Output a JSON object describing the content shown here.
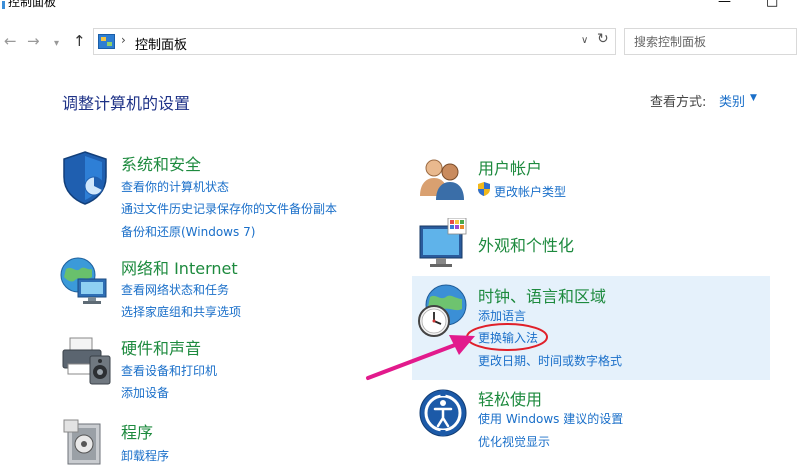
{
  "window": {
    "title": "控制面板",
    "minimize": "—",
    "maximize": "□"
  },
  "nav": {
    "back": "←",
    "forward": "→",
    "recent": "▾",
    "up": "↑",
    "breadcrumb_sep": "›",
    "breadcrumb": "控制面板",
    "dropdown": "∨",
    "refresh": "↻",
    "search_placeholder": "搜索控制面板"
  },
  "header": {
    "title": "调整计算机的设置",
    "view_by_label": "查看方式:",
    "view_by_value": "类别",
    "view_by_caret": "▼"
  },
  "categories": [
    {
      "title": "系统和安全",
      "icon": "shield-icon",
      "links": [
        "查看你的计算机状态",
        "通过文件历史记录保存你的文件备份副本",
        "备份和还原(Windows 7)"
      ]
    },
    {
      "title": "网络和 Internet",
      "icon": "network-globe-icon",
      "links": [
        "查看网络状态和任务",
        "选择家庭组和共享选项"
      ]
    },
    {
      "title": "硬件和声音",
      "icon": "printer-icon",
      "links": [
        "查看设备和打印机",
        "添加设备"
      ]
    },
    {
      "title": "程序",
      "icon": "program-icon",
      "links": [
        "卸载程序"
      ]
    },
    {
      "title": "用户帐户",
      "icon": "users-icon",
      "links": [
        "更改帐户类型"
      ]
    },
    {
      "title": "外观和个性化",
      "icon": "display-icon",
      "links": []
    },
    {
      "title": "时钟、语言和区域",
      "icon": "clock-globe-icon",
      "links": [
        "添加语言",
        "更换输入法",
        "更改日期、时间或数字格式"
      ]
    },
    {
      "title": "轻松使用",
      "icon": "ease-of-access-icon",
      "links": [
        "使用 Windows 建议的设置",
        "优化视觉显示"
      ]
    }
  ],
  "colors": {
    "category_title": "#1d8a3e",
    "link": "#1a6fc9",
    "page_title": "#1e3287",
    "highlight_bg": "#e5f1fb",
    "annotation": "#e21a8c"
  }
}
